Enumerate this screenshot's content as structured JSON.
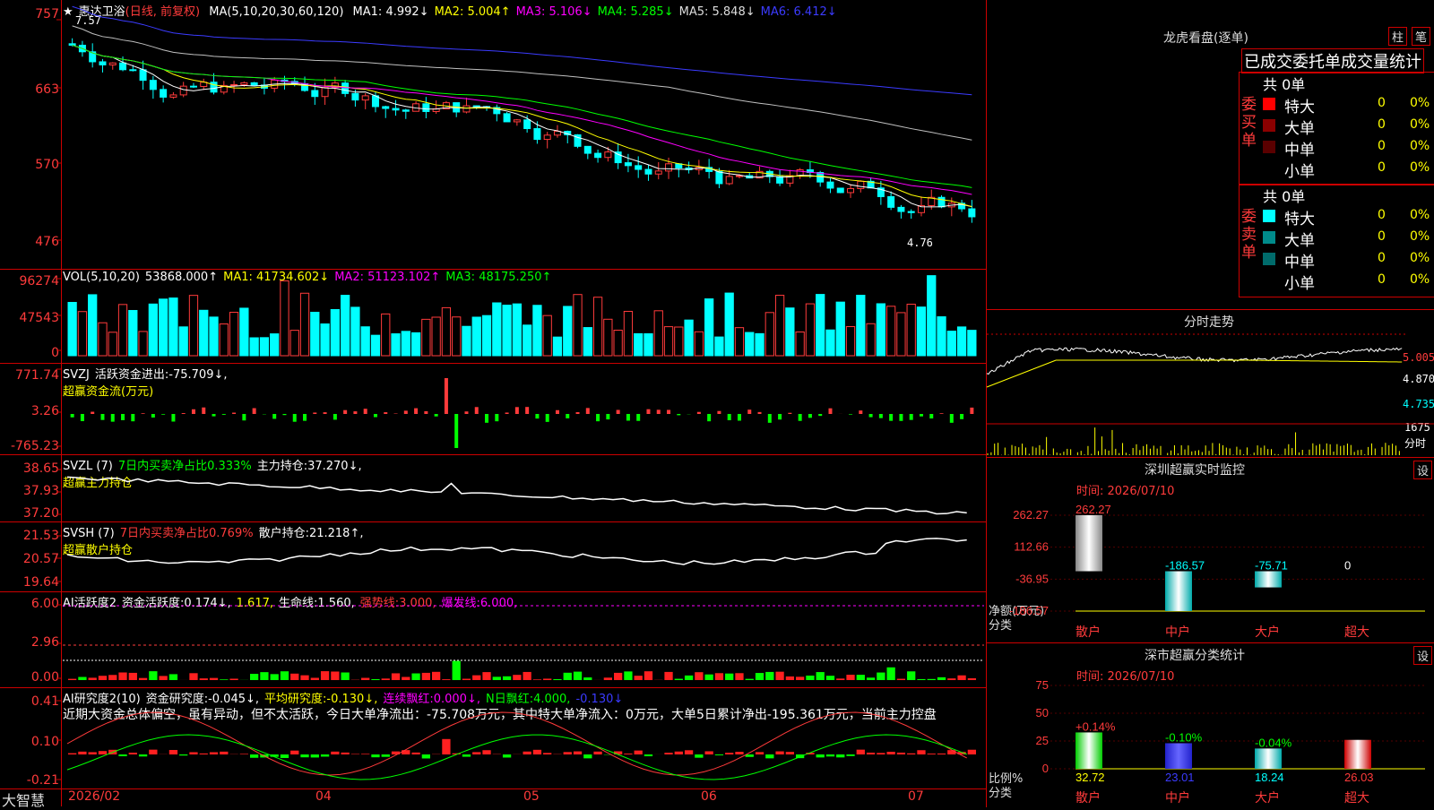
{
  "stock": {
    "star": "★",
    "name": "惠达卫浴",
    "period": "(日线, 前复权)"
  },
  "kline": {
    "ma_label": "MA(5,10,20,30,60,120)",
    "ma": [
      {
        "name": "MA1:",
        "value": "4.992↓",
        "color": "#ffffff"
      },
      {
        "name": "MA2:",
        "value": "5.004↑",
        "color": "#ffff00"
      },
      {
        "name": "MA3:",
        "value": "5.106↓",
        "color": "#ff00ff"
      },
      {
        "name": "MA4:",
        "value": "5.285↓",
        "color": "#00ff00"
      },
      {
        "name": "MA5:",
        "value": "5.848↓",
        "color": "#dddddd"
      },
      {
        "name": "MA6:",
        "value": "6.412↓",
        "color": "#3b3bff"
      }
    ],
    "axis": [
      "757",
      "663",
      "570",
      "476"
    ],
    "high_label": "7.57",
    "low_label": "4.76"
  },
  "vol": {
    "label": "VOL(5,10,20)",
    "value": "53868.000↑",
    "ma": [
      {
        "name": "MA1:",
        "value": "41734.602↓",
        "color": "#ffff00"
      },
      {
        "name": "MA2:",
        "value": "51123.102↑",
        "color": "#ff00ff"
      },
      {
        "name": "MA3:",
        "value": "48175.250↑",
        "color": "#00ff00"
      }
    ],
    "axis": [
      "96274",
      "47543",
      "0"
    ]
  },
  "svzj": {
    "label": "SVZJ",
    "line1": "活跃资金进出:",
    "value": "-75.709↓,",
    "line2": "超赢资金流(万元)",
    "axis": [
      "771.74",
      "3.26",
      "-765.23"
    ]
  },
  "svzl": {
    "label": "SVZL (7)",
    "pct": "7日内买卖净占比0.333%",
    "hold": "主力持仓:",
    "hold_value": "37.270↓,",
    "line2": "超赢主力持仓",
    "axis": [
      "38.65",
      "37.93",
      "37.20"
    ]
  },
  "svsh": {
    "label": "SVSH (7)",
    "pct": "7日内买卖净占比0.769%",
    "hold": "散户持仓:",
    "hold_value": "21.218↑,",
    "line2": "超赢散户持仓",
    "axis": [
      "21.53",
      "20.57",
      "19.64"
    ]
  },
  "ai1": {
    "label": "AI活跃度2",
    "t1": "资金活跃度:",
    "v1": "0.174↓,",
    "v2": "1.617,",
    "t3": "生命线:",
    "v3": "1.560,",
    "t4": "强势线:",
    "v4": "3.000,",
    "t5": "爆发线:",
    "v5": "6.000,",
    "axis": [
      "6.00",
      "2.96",
      "0.00"
    ]
  },
  "ai2": {
    "label": "AI研究度2(10)",
    "t1": "资金研究度:",
    "v1": "-0.045↓,",
    "t2": "平均研究度:",
    "v2": "-0.130↓,",
    "t3": "连续飘红:",
    "v3": "0.000↓,",
    "t4": "N日飘红:",
    "v4": "4.000,",
    "v5": "-0.130↓",
    "comment": "近期大资金总体偏空，虽有异动，但不太活跃，今日大单净流出：-75.708万元，其中特大单净流入：0万元，大单5日累计净出-195.361万元，当前主力控盘",
    "axis": [
      "0.41",
      "0.10",
      "-0.21"
    ]
  },
  "xaxis": {
    "brand": "大智慧",
    "labels": [
      "2026/02",
      "04",
      "05",
      "06",
      "07"
    ]
  },
  "lhb": {
    "title": "龙虎看盘(逐单)",
    "btn1": "柱",
    "btn2": "笔",
    "subtitle": "已成交委托单成交量统计",
    "buy": {
      "label": "委买单",
      "total": "共 0单",
      "rows": [
        {
          "name": "特大",
          "v": "0",
          "p": "0%",
          "color": "#ff0000"
        },
        {
          "name": "大单",
          "v": "0",
          "p": "0%",
          "color": "#8b0000"
        },
        {
          "name": "中单",
          "v": "0",
          "p": "0%",
          "color": "#5a0000"
        },
        {
          "name": "小单",
          "v": "0",
          "p": "0%",
          "color": "#000000"
        }
      ]
    },
    "sell": {
      "label": "委卖单",
      "total": "共 0单",
      "rows": [
        {
          "name": "特大",
          "v": "0",
          "p": "0%",
          "color": "#00ffff"
        },
        {
          "name": "大单",
          "v": "0",
          "p": "0%",
          "color": "#008b8b"
        },
        {
          "name": "中单",
          "v": "0",
          "p": "0%",
          "color": "#006b6b"
        },
        {
          "name": "小单",
          "v": "0",
          "p": "0%",
          "color": "#000000"
        }
      ]
    }
  },
  "intraday": {
    "title": "分时走势",
    "axis": [
      "5.005",
      "4.870",
      "4.735"
    ],
    "vol_axis": [
      "1675",
      "分时"
    ]
  },
  "monitor": {
    "title": "深圳超赢实时监控",
    "btn": "设",
    "date": "时间: 2026/07/10",
    "axis": [
      "262.27",
      "112.66",
      "-36.95",
      "-186.57"
    ],
    "unit1": "净额(万元)",
    "unit2": "分类",
    "values": [
      "262.27",
      "-186.57",
      "-75.71",
      "0"
    ],
    "cats": [
      "散户",
      "中户",
      "大户",
      "超大"
    ]
  },
  "classify": {
    "title": "深市超赢分类统计",
    "btn": "设",
    "date": "时间: 2026/07/10",
    "axis": [
      "75",
      "50",
      "25",
      "0"
    ],
    "unit1": "比例%",
    "unit2": "分类",
    "top": [
      "+0.14%",
      "-0.10%",
      "-0.04%",
      ""
    ],
    "bottom": [
      "32.72",
      "23.01",
      "18.24",
      "26.03"
    ],
    "cats": [
      "散户",
      "中户",
      "大户",
      "超大"
    ]
  }
}
